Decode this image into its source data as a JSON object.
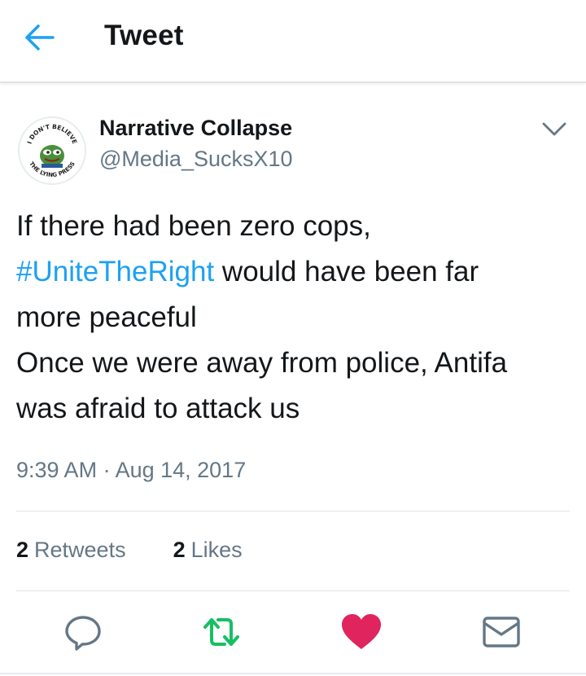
{
  "header": {
    "title": "Tweet",
    "back_icon": "arrow-left-icon",
    "accent_color": "#1da1f2"
  },
  "tweet": {
    "author": {
      "name": "Narrative Collapse",
      "handle": "@Media_SucksX10",
      "avatar": {
        "top_text": "I DON'T BELIEVE",
        "bottom_text": "THE LYING PRESS"
      }
    },
    "text": {
      "line1": "If there had been zero cops,",
      "hashtag": "#UniteTheRight",
      "line2_rest": " would have been far",
      "line3": "more peaceful",
      "line4": "Once we were away from police, Antifa",
      "line5": "was afraid to attack us"
    },
    "timestamp": "9:39 AM · Aug 14, 2017",
    "stats": {
      "retweets_count": "2",
      "retweets_label": "Retweets",
      "likes_count": "2",
      "likes_label": "Likes"
    },
    "actions": {
      "reply_icon": "reply-icon",
      "retweet_icon": "retweet-icon",
      "like_icon": "heart-icon",
      "share_icon": "mail-icon",
      "retweet_color": "#17bf63",
      "like_color": "#e0245e"
    }
  }
}
